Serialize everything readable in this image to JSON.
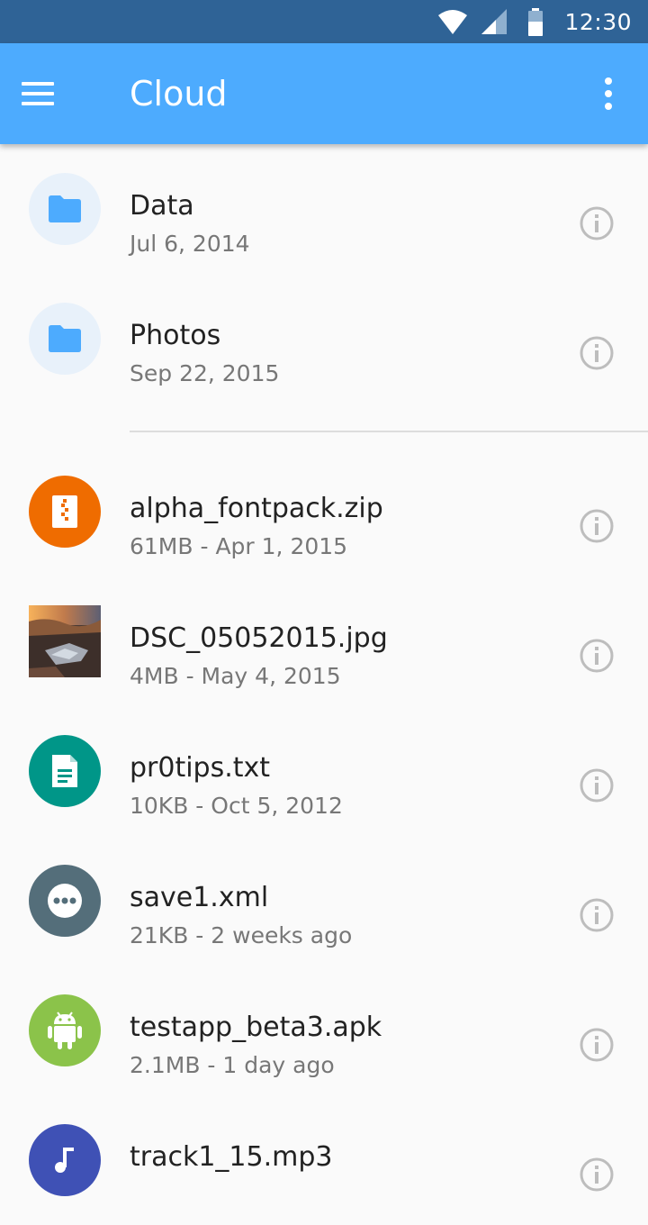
{
  "status_bar": {
    "time": "12:30",
    "icons": [
      "wifi-icon",
      "cell-signal-icon",
      "battery-icon"
    ]
  },
  "app_bar": {
    "title": "Cloud",
    "menu_icon": "hamburger-menu-icon",
    "overflow_icon": "more-vert-icon"
  },
  "folders": [
    {
      "name": "Data",
      "date": "Jul 6, 2014",
      "icon": "folder-icon"
    },
    {
      "name": "Photos",
      "date": "Sep 22, 2015",
      "icon": "folder-icon"
    }
  ],
  "files": [
    {
      "name": "alpha_fontpack.zip",
      "meta": "61MB - Apr 1, 2015",
      "icon": "zip-icon",
      "color": "#ef6c00"
    },
    {
      "name": "DSC_05052015.jpg",
      "meta": "4MB - May 4, 2015",
      "icon": "image-thumbnail"
    },
    {
      "name": "pr0tips.txt",
      "meta": "10KB - Oct 5, 2012",
      "icon": "document-icon",
      "color": "#009688"
    },
    {
      "name": "save1.xml",
      "meta": "21KB - 2 weeks ago",
      "icon": "more-horiz-icon",
      "color": "#546e7a"
    },
    {
      "name": "testapp_beta3.apk",
      "meta": "2.1MB - 1 day ago",
      "icon": "android-icon",
      "color": "#8bc34a"
    },
    {
      "name": "track1_15.mp3",
      "meta": "",
      "icon": "music-icon",
      "color": "#3f51b5"
    }
  ],
  "colors": {
    "status_bar": "#2f6396",
    "app_bar": "#4dabfe",
    "folder_icon": "#4dabfe",
    "folder_bg": "#e8f1fa",
    "info_icon": "#bdbdbd"
  }
}
